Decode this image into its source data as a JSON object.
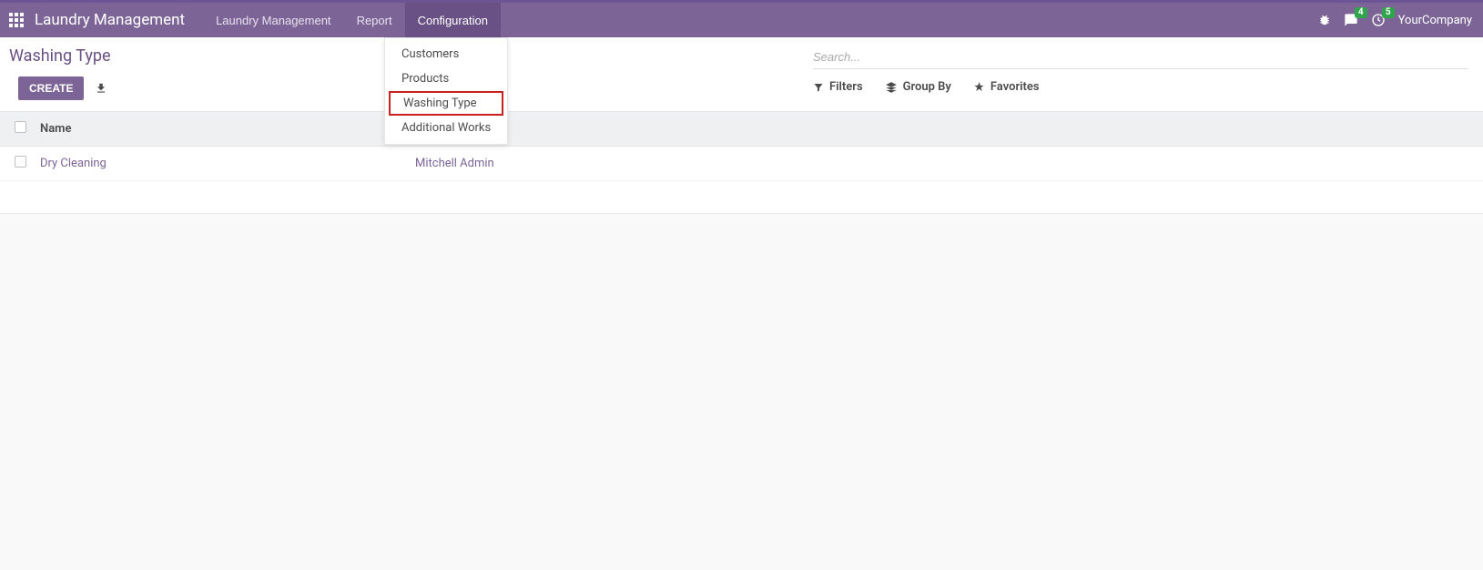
{
  "navbar": {
    "brand": "Laundry Management",
    "menu": [
      {
        "label": "Laundry Management",
        "active": false
      },
      {
        "label": "Report",
        "active": false
      },
      {
        "label": "Configuration",
        "active": true
      }
    ],
    "badges": {
      "messages": "4",
      "activities": "5"
    },
    "company": "YourCompany"
  },
  "dropdown": {
    "items": [
      {
        "label": "Customers",
        "highlighted": false
      },
      {
        "label": "Products",
        "highlighted": false
      },
      {
        "label": "Washing Type",
        "highlighted": true
      },
      {
        "label": "Additional Works",
        "highlighted": false
      }
    ]
  },
  "breadcrumb": "Washing Type",
  "buttons": {
    "create": "CREATE"
  },
  "search": {
    "placeholder": "Search...",
    "filters": "Filters",
    "group_by": "Group By",
    "favorites": "Favorites"
  },
  "list": {
    "header_name": "Name",
    "rows": [
      {
        "name": "Dry Cleaning",
        "assignee": "Mitchell Admin"
      }
    ]
  }
}
